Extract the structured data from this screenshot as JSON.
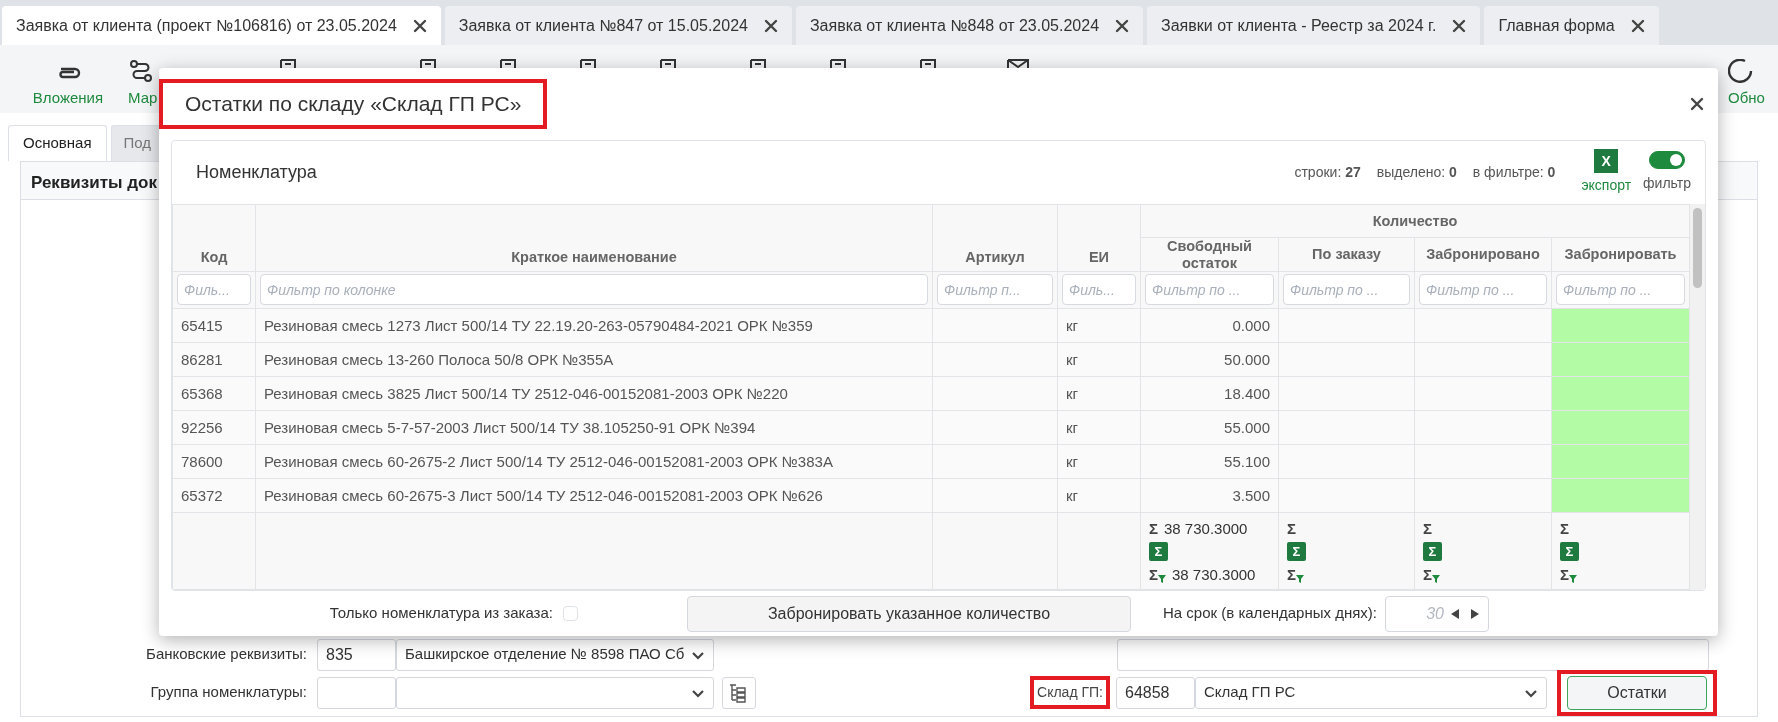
{
  "doc_tabs": [
    {
      "label": "Заявка от клиента (проект №106816) от 23.05.2024",
      "selected": true
    },
    {
      "label": "Заявка от клиента №847 от 15.05.2024",
      "selected": false
    },
    {
      "label": "Заявка от клиента №848 от 23.05.2024",
      "selected": false
    },
    {
      "label": "Заявки от клиента - Реестр за 2024 г.",
      "selected": false
    },
    {
      "label": "Главная форма",
      "selected": false
    }
  ],
  "toolbar": {
    "left": [
      "Вложения",
      "Мар"
    ],
    "right": [
      "Обно"
    ]
  },
  "form_tabs": [
    {
      "label": "Основная",
      "selected": true
    },
    {
      "label": "Под",
      "selected": false
    }
  ],
  "section_title": "Реквизиты док",
  "bank": {
    "label": "Банковские реквизиты:",
    "code": "835",
    "value": "Башкирское отделение № 8598 ПАО Сб"
  },
  "group": {
    "label": "Группа номенклатуры:"
  },
  "warehouse": {
    "label": "Склад ГП:",
    "highlighted": true,
    "code": "64858",
    "value": "Склад ГП РС"
  },
  "stock_button": {
    "label": "Остатки",
    "highlighted": true
  },
  "modal": {
    "title": "Остатки по складу «Склад ГП РС»",
    "highlighted": true,
    "panel_title": "Номенклатура",
    "stats": [
      {
        "label": "строки:",
        "value": "27"
      },
      {
        "label": "выделено:",
        "value": "0"
      },
      {
        "label": "в фильтре:",
        "value": "0"
      }
    ],
    "export": {
      "icon_text": "X",
      "label": "экспорт"
    },
    "filter": {
      "label": "фильтр",
      "on": true
    },
    "table": {
      "group_header": "Количество",
      "columns": [
        {
          "title": "Код",
          "placeholder": "Филь...",
          "grouped": false,
          "editable": false
        },
        {
          "title": "Краткое наименование",
          "placeholder": "Фильтр по колонке",
          "grouped": false,
          "editable": false
        },
        {
          "title": "Артикул",
          "placeholder": "Фильтр п...",
          "grouped": false,
          "editable": false
        },
        {
          "title": "ЕИ",
          "placeholder": "Филь...",
          "grouped": false,
          "editable": false
        },
        {
          "title": "Свободный остаток",
          "placeholder": "Фильтр по ...",
          "grouped": true,
          "editable": false
        },
        {
          "title": "По заказу",
          "placeholder": "Фильтр по ...",
          "grouped": true,
          "editable": false
        },
        {
          "title": "Забронировано",
          "placeholder": "Фильтр по ...",
          "grouped": true,
          "editable": false
        },
        {
          "title": "Забронировать",
          "placeholder": "Фильтр по ...",
          "grouped": true,
          "editable": true
        }
      ],
      "rows": [
        {
          "code": "65415",
          "name": "Резиновая смесь 1273 Лист 500/14 ТУ 22.19.20-263-05790484-2021 ОРК №359",
          "unit": "кг",
          "free_stock": "0.000"
        },
        {
          "code": "86281",
          "name": "Резиновая смесь 13-260 Полоса 50/8 ОРК №355А",
          "unit": "кг",
          "free_stock": "50.000"
        },
        {
          "code": "65368",
          "name": "Резиновая смесь 3825 Лист 500/14 ТУ 2512-046-00152081-2003 ОРК №220",
          "unit": "кг",
          "free_stock": "18.400"
        },
        {
          "code": "92256",
          "name": "Резиновая смесь 5-7-57-2003 Лист 500/14 ТУ 38.105250-91 ОРК №394",
          "unit": "кг",
          "free_stock": "55.000"
        },
        {
          "code": "78600",
          "name": "Резиновая смесь 60-2675-2 Лист 500/14 ТУ 2512-046-00152081-2003 ОРК №383А",
          "unit": "кг",
          "free_stock": "55.100"
        },
        {
          "code": "65372",
          "name": "Резиновая смесь 60-2675-3 Лист 500/14 ТУ 2512-046-00152081-2003 ОРК №626",
          "unit": "кг",
          "free_stock": "3.500"
        }
      ],
      "totals": [
        {
          "sign": "Σ",
          "sum": "38 730.3000",
          "button": "Σ",
          "filtered_sign": "Σ",
          "filtered_sum": "38 730.3000"
        },
        {
          "sign": "Σ",
          "button": "Σ",
          "filtered_sign": "Σ"
        },
        {
          "sign": "Σ",
          "button": "Σ",
          "filtered_sign": "Σ"
        },
        {
          "sign": "Σ",
          "button": "Σ",
          "filtered_sign": "Σ"
        }
      ]
    },
    "only_order": {
      "label": "Только номенклатура из заказа:",
      "checked": false
    },
    "reserve_button": "Забронировать указанное количество",
    "days": {
      "label": "На срок (в календарных днях):",
      "placeholder": "30"
    }
  }
}
